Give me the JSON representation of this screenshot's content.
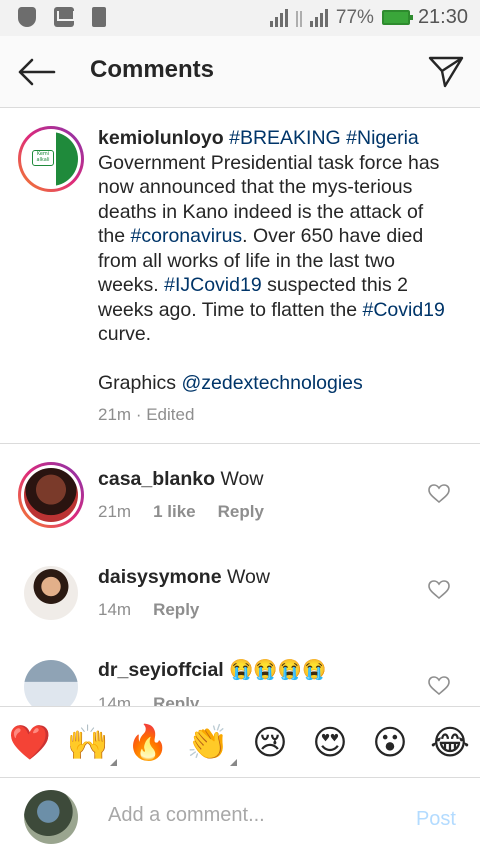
{
  "status_bar": {
    "battery": "77%",
    "time": "21:30"
  },
  "header": {
    "title": "Comments"
  },
  "caption": {
    "username": "kemiolunloyo",
    "logo_text": "Kemi\nalkali",
    "segments": [
      {
        "text": "#BREAKING",
        "type": "tag"
      },
      {
        "text": " ",
        "type": "plain"
      },
      {
        "text": "#Nigeria",
        "type": "tag"
      },
      {
        "text": " Government Presidential task force has now announced that the mys-terious deaths in Kano indeed is the attack of the ",
        "type": "plain"
      },
      {
        "text": "#coronavirus",
        "type": "tag"
      },
      {
        "text": ". Over 650 have died from all works of life in the last two weeks. ",
        "type": "plain"
      },
      {
        "text": "#IJCovid19",
        "type": "tag"
      },
      {
        "text": " suspected this 2 weeks ago. Time to flatten the ",
        "type": "plain"
      },
      {
        "text": "#Covid19",
        "type": "tag"
      },
      {
        "text": " curve.",
        "type": "plain"
      }
    ],
    "graphics_prefix": "Graphics ",
    "graphics_mention": "@zedextechnologies",
    "time": "21m",
    "edited": "· Edited"
  },
  "comments": [
    {
      "username": "casa_blanko",
      "text": "Wow",
      "time": "21m",
      "likes": "1 like",
      "reply": "Reply"
    },
    {
      "username": "daisysymone",
      "text": "Wow",
      "time": "14m",
      "reply": "Reply"
    },
    {
      "username": "dr_seyioffcial",
      "text": "😭😭😭😭",
      "time": "14m",
      "reply": "Reply"
    }
  ],
  "emoji_bar": [
    "❤️",
    "🙌",
    "🔥",
    "👏",
    "😢",
    "😍",
    "😮",
    "😂"
  ],
  "composer": {
    "placeholder": "Add a comment...",
    "post_label": "Post"
  },
  "colors": {
    "hashtag": "#003569",
    "post_disabled": "#b3dbff",
    "meta_gray": "#8e8e8e"
  }
}
